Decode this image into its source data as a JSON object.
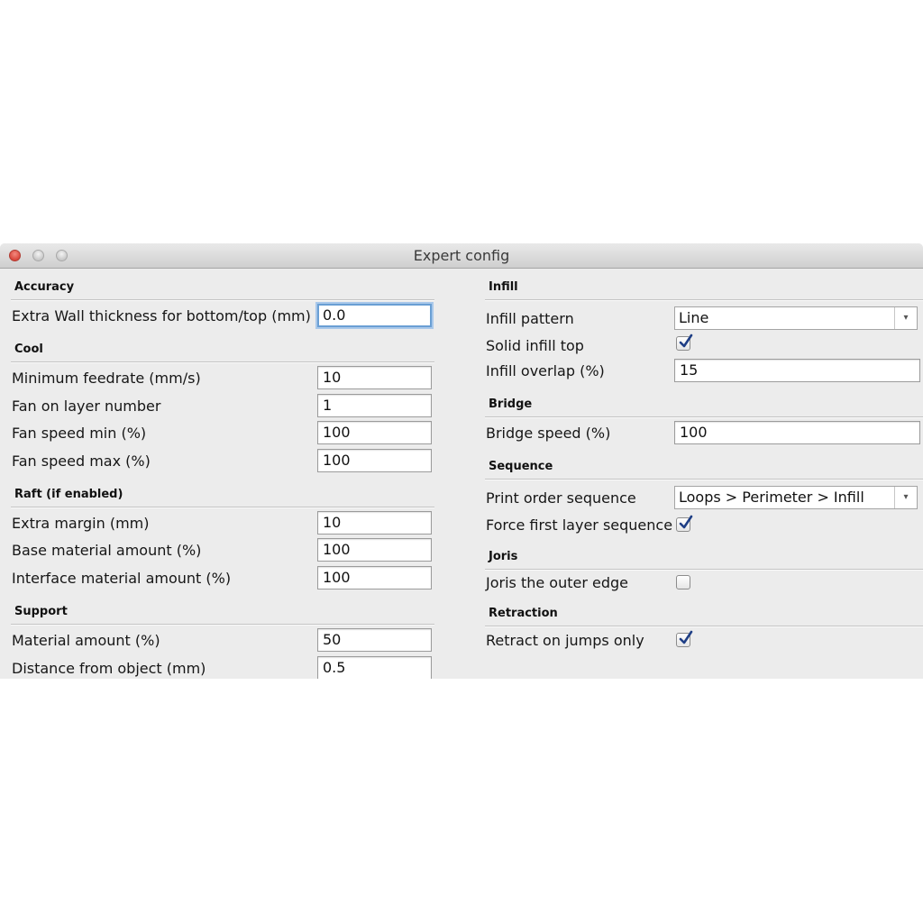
{
  "window": {
    "title": "Expert config"
  },
  "left": {
    "accuracy": {
      "header": "Accuracy",
      "extra_wall_label": "Extra Wall thickness for bottom/top (mm)",
      "extra_wall_value": "0.0"
    },
    "cool": {
      "header": "Cool",
      "min_feedrate_label": "Minimum feedrate (mm/s)",
      "min_feedrate_value": "10",
      "fan_layer_label": "Fan on layer number",
      "fan_layer_value": "1",
      "fan_min_label": "Fan speed min (%)",
      "fan_min_value": "100",
      "fan_max_label": "Fan speed max (%)",
      "fan_max_value": "100"
    },
    "raft": {
      "header": "Raft (if enabled)",
      "extra_margin_label": "Extra margin (mm)",
      "extra_margin_value": "10",
      "base_material_label": "Base material amount (%)",
      "base_material_value": "100",
      "interface_material_label": "Interface material amount (%)",
      "interface_material_value": "100"
    },
    "support": {
      "header": "Support",
      "material_amount_label": "Material amount (%)",
      "material_amount_value": "50",
      "distance_label": "Distance from object (mm)",
      "distance_value": "0.5"
    }
  },
  "right": {
    "infill": {
      "header": "Infill",
      "pattern_label": "Infill pattern",
      "pattern_value": "Line",
      "solid_top_label": "Solid infill top",
      "solid_top_checked": true,
      "overlap_label": "Infill overlap (%)",
      "overlap_value": "15"
    },
    "bridge": {
      "header": "Bridge",
      "speed_label": "Bridge speed (%)",
      "speed_value": "100"
    },
    "sequence": {
      "header": "Sequence",
      "print_order_label": "Print order sequence",
      "print_order_value": "Loops > Perimeter > Infill",
      "force_first_label": "Force first layer sequence",
      "force_first_checked": true
    },
    "joris": {
      "header": "Joris",
      "outer_edge_label": "Joris the outer edge",
      "outer_edge_checked": false
    },
    "retraction": {
      "header": "Retraction",
      "jumps_only_label": "Retract on jumps only",
      "jumps_only_checked": true
    }
  },
  "icons": {
    "dropdown_arrow": "▾",
    "checkmark": "check-icon"
  },
  "colors": {
    "focus_ring": "#6a9fd4",
    "check": "#1f3f86",
    "close_light": "#d9473c"
  }
}
